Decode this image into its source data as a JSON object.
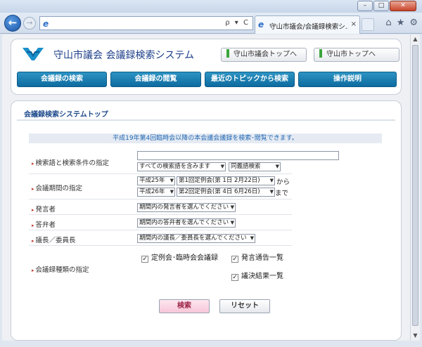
{
  "window": {
    "minimize": "–",
    "maximize": "□",
    "close": "✕"
  },
  "browser": {
    "back_glyph": "←",
    "forward_glyph": "→",
    "address_tools": "ρ ▾ C",
    "tab_title": "守山市議会/会議録検索シ...",
    "tab_close": "×",
    "icons": [
      "home-icon",
      "star-icon",
      "gear-icon"
    ],
    "home_glyph": "⌂",
    "star_glyph": "★",
    "gear_glyph": "⚙"
  },
  "header": {
    "site_title": "守山市議会  会議録検索システム",
    "link_council": "守山市議会トップへ",
    "link_city": "守山市トップへ",
    "menu": {
      "search": "会議録の検索",
      "browse": "会議録の閲覧",
      "topics": "最近のトピックから検索",
      "help": "操作説明"
    }
  },
  "main": {
    "panel_title": "会議録検索システムトップ",
    "notice": "平成19年第4回臨時会以降の本会議会議録を検索･閲覧できます。",
    "fields": {
      "keyword_label": "検索語と検索条件の指定",
      "keyword_value": "",
      "condition": "すべての検索語を含みます",
      "synonym": "同義語検索",
      "period_label": "会議期間の指定",
      "from_year": "平成25年",
      "from_session": "第1回定例会(第 1日 2月22日)",
      "from_suffix": "から",
      "to_year": "平成26年",
      "to_session": "第2回定例会(第 4日 6月26日)",
      "to_suffix": "まで",
      "speaker_label": "発言者",
      "speaker_select": "期間内の発言者を選んでください",
      "respondent_label": "答弁者",
      "respondent_select": "期間内の答弁者を選んでください",
      "chair_label": "議長／委員長",
      "chair_select": "期間内の議長／委員長を選んでください",
      "type_label": "会議録種類の指定",
      "type_regular": "定例会･臨時会会議録",
      "type_notice": "発言通告一覧",
      "type_result": "議決結果一覧"
    },
    "search_button": "検索",
    "reset_button": "リセット"
  }
}
